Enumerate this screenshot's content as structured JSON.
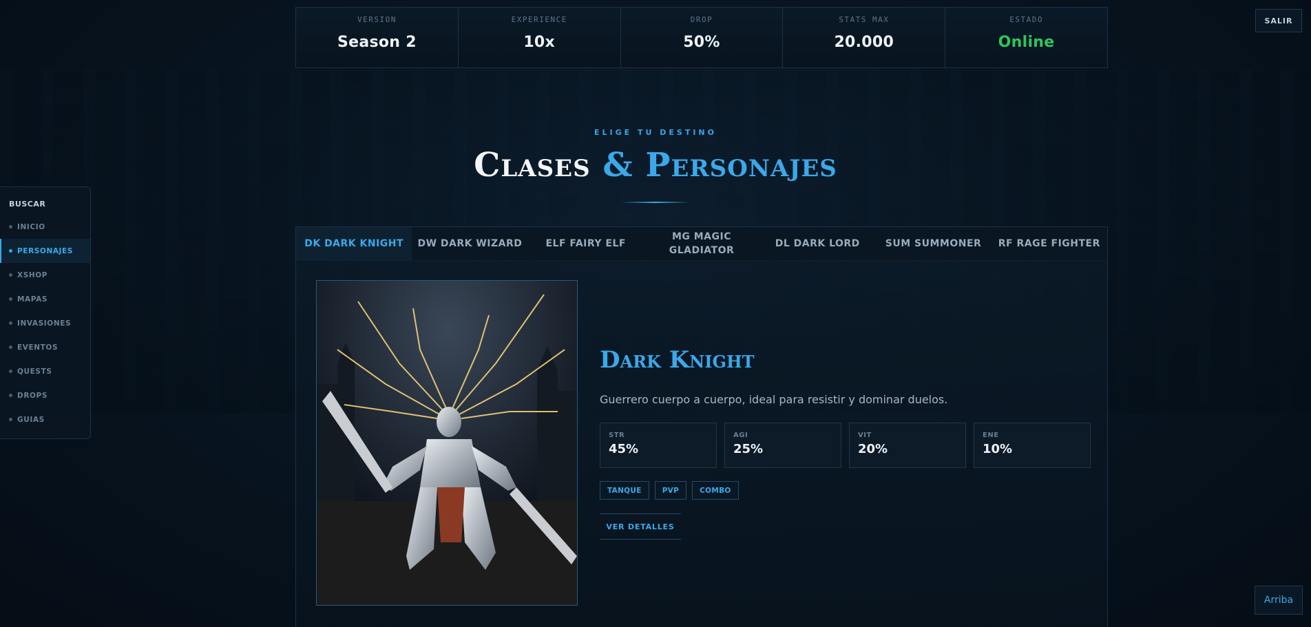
{
  "stats": [
    {
      "label": "VERSION",
      "value": "Season 2"
    },
    {
      "label": "EXPERIENCE",
      "value": "10x"
    },
    {
      "label": "DROP",
      "value": "50%"
    },
    {
      "label": "STATS MAX",
      "value": "20.000"
    },
    {
      "label": "ESTADO",
      "value": "Online"
    }
  ],
  "header": {
    "logout_label": "SALIR"
  },
  "section": {
    "eyebrow": "ELIGE TU DESTINO",
    "title_part1": "Clases",
    "title_part2": "& Personajes"
  },
  "sidebar": {
    "search_label": "BUSCAR",
    "items": [
      {
        "label": "INICIO"
      },
      {
        "label": "PERSONAJES",
        "active": true
      },
      {
        "label": "XSHOP"
      },
      {
        "label": "MAPAS"
      },
      {
        "label": "INVASIONES"
      },
      {
        "label": "EVENTOS"
      },
      {
        "label": "QUESTS"
      },
      {
        "label": "DROPS"
      },
      {
        "label": "GUIAS"
      }
    ]
  },
  "tabs": [
    {
      "label": "DK DARK KNIGHT",
      "active": true
    },
    {
      "label": "DW DARK WIZARD"
    },
    {
      "label": "ELF FAIRY ELF"
    },
    {
      "label": "MG MAGIC GLADIATOR"
    },
    {
      "label": "DL DARK LORD"
    },
    {
      "label": "SUM SUMMONER"
    },
    {
      "label": "RF RAGE FIGHTER"
    }
  ],
  "character": {
    "name": "Dark Knight",
    "description": "Guerrero cuerpo a cuerpo, ideal para resistir y dominar duelos.",
    "attributes": [
      {
        "label": "STR",
        "value": "45%"
      },
      {
        "label": "AGI",
        "value": "25%"
      },
      {
        "label": "VIT",
        "value": "20%"
      },
      {
        "label": "ENE",
        "value": "10%"
      }
    ],
    "tags": [
      "TANQUE",
      "PVP",
      "COMBO"
    ],
    "details_label": "VER DETALLES"
  },
  "footer": {
    "top_label": "Arriba"
  },
  "colors": {
    "accent": "#3aa9ea",
    "online": "#2ec65b",
    "background": "#081521"
  }
}
